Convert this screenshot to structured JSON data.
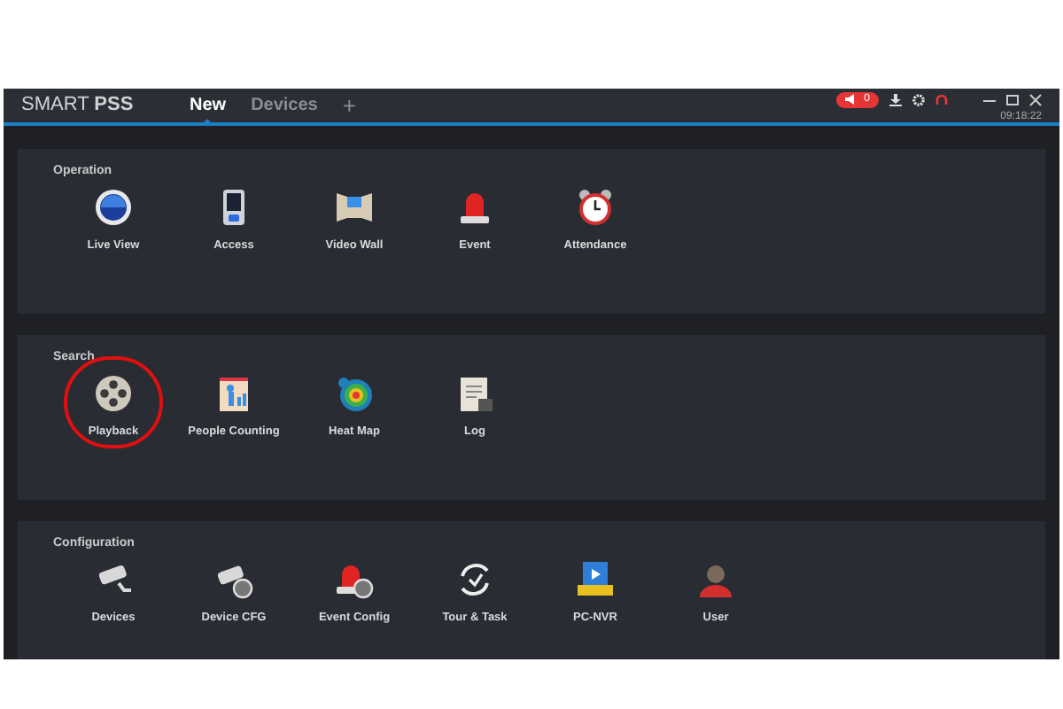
{
  "app": {
    "brand_light": "SMART ",
    "brand_bold": "PSS"
  },
  "tabs": [
    {
      "label": "New",
      "selected": true
    },
    {
      "label": "Devices",
      "selected": false
    }
  ],
  "add_tab": "+",
  "alarm_badge": "0",
  "clock": "09:18:22",
  "sections": [
    {
      "title": "Operation",
      "items": [
        {
          "label": "Live View",
          "highlighted": false
        },
        {
          "label": "Access",
          "highlighted": false
        },
        {
          "label": "Video Wall",
          "highlighted": false
        },
        {
          "label": "Event",
          "highlighted": false
        },
        {
          "label": "Attendance",
          "highlighted": false
        }
      ]
    },
    {
      "title": "Search",
      "items": [
        {
          "label": "Playback",
          "highlighted": true
        },
        {
          "label": "People Counting",
          "highlighted": false
        },
        {
          "label": "Heat Map",
          "highlighted": false
        },
        {
          "label": "Log",
          "highlighted": false
        }
      ]
    },
    {
      "title": "Configuration",
      "items": [
        {
          "label": "Devices",
          "highlighted": false
        },
        {
          "label": "Device CFG",
          "highlighted": false
        },
        {
          "label": "Event Config",
          "highlighted": false
        },
        {
          "label": "Tour & Task",
          "highlighted": false
        },
        {
          "label": "PC-NVR",
          "highlighted": false
        },
        {
          "label": "User",
          "highlighted": false
        }
      ]
    }
  ]
}
